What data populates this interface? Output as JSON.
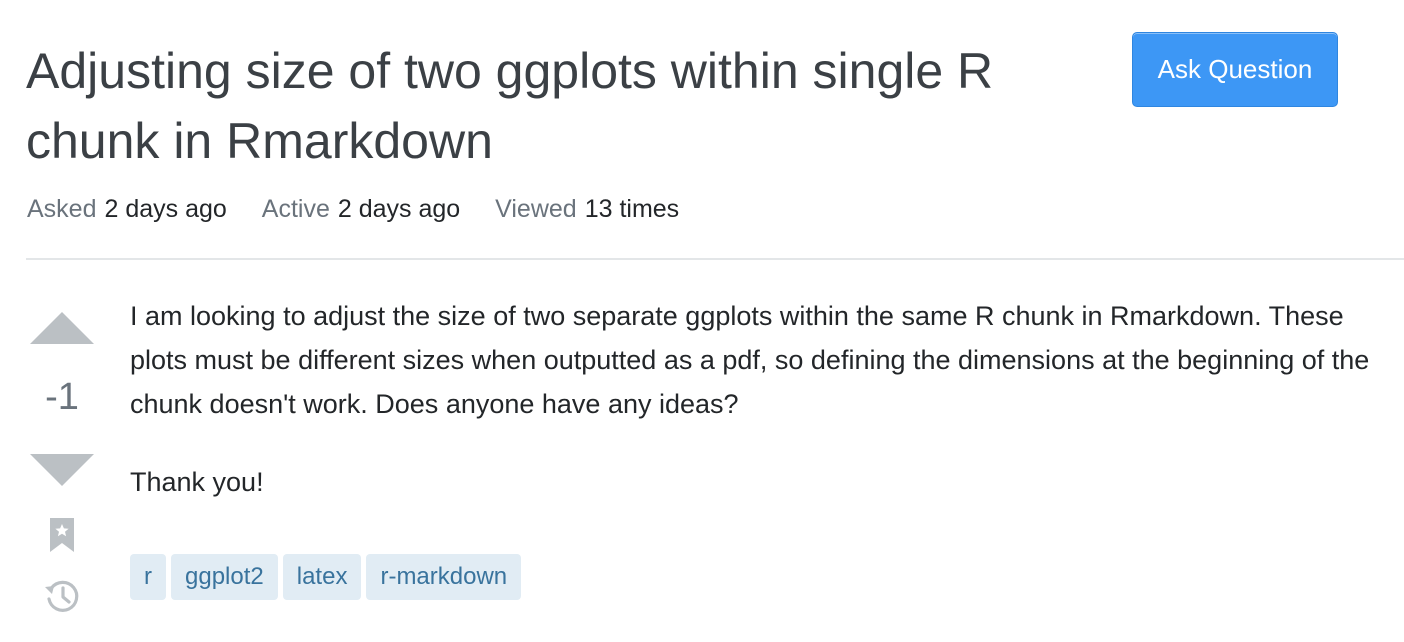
{
  "question": {
    "title": "Adjusting size of two ggplots within single R chunk in Rmarkdown",
    "ask_button_label": "Ask Question",
    "meta": {
      "asked_label": "Asked",
      "asked_value": "2 days ago",
      "active_label": "Active",
      "active_value": "2 days ago",
      "viewed_label": "Viewed",
      "viewed_value": "13 times"
    },
    "vote_count": "-1",
    "body": [
      "I am looking to adjust the size of two separate ggplots within the same R chunk in Rmarkdown. These plots must be different sizes when outputted as a pdf, so defining the dimensions at the beginning of the chunk doesn't work. Does anyone have any ideas?",
      "Thank you!"
    ],
    "tags": [
      "r",
      "ggplot2",
      "latex",
      "r-markdown"
    ]
  },
  "icons": {
    "vote_up": "triangle-up-icon",
    "vote_down": "triangle-down-icon",
    "bookmark": "bookmark-icon",
    "history": "history-icon"
  },
  "colors": {
    "accent": "#3d97f5",
    "tag_background": "#e1ecf4",
    "tag_text": "#39739d",
    "vote_arrow": "#bbc0c4"
  }
}
